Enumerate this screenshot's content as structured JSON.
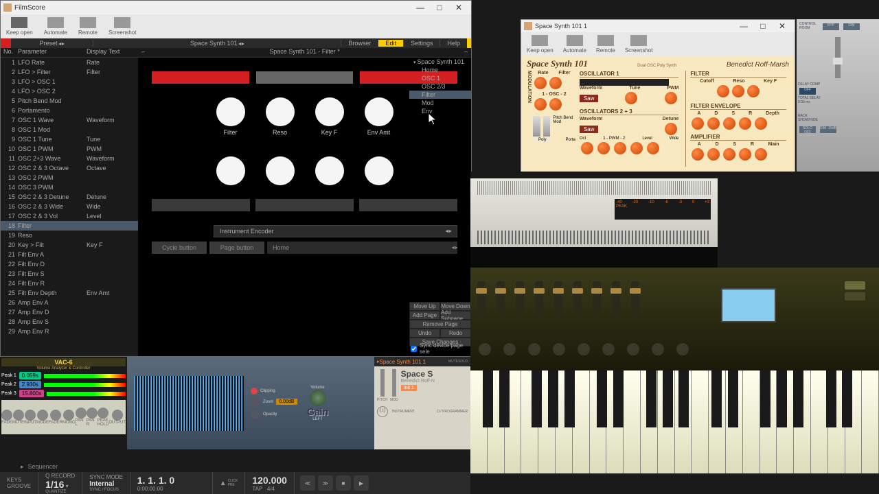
{
  "filmscore": {
    "title": "FilmScore",
    "toolbar": [
      "Keep open",
      "Automate",
      "Remote",
      "Screenshot"
    ],
    "menu": {
      "preset": "Preset",
      "device": "Space Synth 101",
      "browser": "Browser",
      "edit": "Edit",
      "settings": "Settings",
      "help": "Help"
    },
    "page_title": "Space Synth 101 - Filter *",
    "columns": {
      "no": "No.",
      "param": "Parameter",
      "display": "Display Text"
    },
    "params": [
      {
        "n": 1,
        "p": "LFO Rate",
        "d": "Rate"
      },
      {
        "n": 2,
        "p": "LFO > Filter",
        "d": "Filter"
      },
      {
        "n": 3,
        "p": "LFO > OSC 1",
        "d": ""
      },
      {
        "n": 4,
        "p": "LFO > OSC 2",
        "d": ""
      },
      {
        "n": 5,
        "p": "Pitch Bend Mod",
        "d": ""
      },
      {
        "n": 6,
        "p": "Portamento",
        "d": ""
      },
      {
        "n": 7,
        "p": "OSC 1 Wave",
        "d": "Waveform"
      },
      {
        "n": 8,
        "p": "OSC 1 Mod",
        "d": ""
      },
      {
        "n": 9,
        "p": "OSC 1 Tune",
        "d": "Tune"
      },
      {
        "n": 10,
        "p": "OSC 1 PWM",
        "d": "PWM"
      },
      {
        "n": 11,
        "p": "OSC 2+3 Wave",
        "d": "Waveform"
      },
      {
        "n": 12,
        "p": "OSC 2 & 3 Octave",
        "d": "Octave"
      },
      {
        "n": 13,
        "p": "OSC 2 PWM",
        "d": ""
      },
      {
        "n": 14,
        "p": "OSC 3 PWM",
        "d": ""
      },
      {
        "n": 15,
        "p": "OSC 2 & 3 Detune",
        "d": "Detune"
      },
      {
        "n": 16,
        "p": "OSC 2 & 3 Wide",
        "d": "Wide"
      },
      {
        "n": 17,
        "p": "OSC 2 & 3 Vol",
        "d": "Level"
      },
      {
        "n": 18,
        "p": "Filter",
        "d": ""
      },
      {
        "n": 19,
        "p": "Reso",
        "d": ""
      },
      {
        "n": 20,
        "p": "Key > Filt",
        "d": "Key F"
      },
      {
        "n": 21,
        "p": "Filt Env A",
        "d": ""
      },
      {
        "n": 22,
        "p": "Filt Env D",
        "d": ""
      },
      {
        "n": 23,
        "p": "Filt Env S",
        "d": ""
      },
      {
        "n": 24,
        "p": "Filt Env R",
        "d": ""
      },
      {
        "n": 25,
        "p": "Filt Env Depth",
        "d": "Env Amt"
      },
      {
        "n": 26,
        "p": "Amp Env A",
        "d": ""
      },
      {
        "n": 27,
        "p": "Amp Env D",
        "d": ""
      },
      {
        "n": 28,
        "p": "Amp Env S",
        "d": ""
      },
      {
        "n": 29,
        "p": "Amp Env R",
        "d": ""
      }
    ],
    "selected_param": 18,
    "knobs": [
      "Filter",
      "Reso",
      "Key F",
      "Env Amt"
    ],
    "encoder_dropdown": "Instrument Encoder",
    "btns": {
      "cycle": "Cycle button",
      "page": "Page button",
      "home": "Home"
    },
    "tree": {
      "root": "Space Synth 101",
      "items": [
        "Home",
        "OSC 1",
        "OSC 2/3",
        "Filter",
        "Mod",
        "Env"
      ]
    },
    "actions": [
      "Move Up",
      "Move Down",
      "Add Page",
      "Add Subpage",
      "Remove Page",
      "Undo",
      "Redo",
      "Save Changes"
    ],
    "sync": "Sync device page sele"
  },
  "synth": {
    "title": "Space Synth 101 1",
    "toolbar": [
      "Keep open",
      "Automate",
      "Remote",
      "Screenshot"
    ],
    "name": "Space Synth 101",
    "subtitle": "Dual OSC Poly Synth",
    "author": "Benedict Roff-Marsh",
    "mod_labels": [
      "Rate",
      "Filter"
    ],
    "mod_bottom": "1 - OSC - 2",
    "osc1": {
      "title": "OSCILLATOR 1",
      "labels": [
        "Waveform",
        "Tune",
        "PWM"
      ],
      "wave": "Saw"
    },
    "osc23": {
      "title": "OSCILLATORS 2 + 3",
      "labels": [
        "Waveform",
        "Detune"
      ],
      "wave": "Saw",
      "bottom": [
        "Oct",
        "1 - PWM - 2",
        "Level",
        "Wide"
      ]
    },
    "filter": {
      "title": "FILTER",
      "labels": [
        "Cutoff",
        "Reso",
        "Key F"
      ]
    },
    "filtenv": {
      "title": "FILTER ENVELOPE",
      "labels": [
        "A",
        "D",
        "S",
        "R",
        "Depth"
      ]
    },
    "amp": {
      "title": "AMPLIFIER",
      "labels": [
        "A",
        "D",
        "S",
        "R",
        "Main"
      ]
    },
    "pitch": "Pitch Bend Mod",
    "porta": "Porta",
    "poly": "Poly"
  },
  "transport": {
    "keys": "KEYS",
    "groove": "GROOVE",
    "qrecord": "Q RECORD",
    "quantize": "QUANTIZE",
    "q_val": "1/16",
    "sync": "SYNC MODE",
    "sync_val": "Internal",
    "sync_sub": "SYNC / FOCUS",
    "pos": "1.  1.  1.    0",
    "time": "0:00:00:00",
    "tempo": "120.000",
    "sig": "4/4",
    "tap": "TAP",
    "click": "CLICK",
    "pre": "PRE"
  },
  "sequencer": "Sequencer",
  "vac": {
    "title": "VAC-6",
    "sub": "Volume Analyzer & Controller",
    "peaks": [
      {
        "label": "Peak 1",
        "val": "0.059s"
      },
      {
        "label": "Peak 2",
        "val": "2.930s"
      },
      {
        "label": "Peak 3",
        "val": "15.800s"
      }
    ],
    "knobs": [
      "FADE",
      "MUTE",
      "INPUT",
      "MODE",
      "FADER",
      "MONO",
      "PAN L",
      "PAN R",
      "PEAK HOLD",
      "OUTPUT"
    ]
  },
  "mixer": {
    "clipping": "Clipping",
    "zoom": "Zoom",
    "opacity": "Opacity",
    "volume": "Volume",
    "volume_val": "0.00dB",
    "gain": "Gain",
    "left": "LEFT"
  },
  "strip": {
    "header": "Space Synth 101 1",
    "mute": "MUTE",
    "solo": "SOLO",
    "name": "Space S",
    "author": "Benedict Roff-N",
    "init": "Init 1",
    "pitch": "PITCH",
    "mod": "MOD",
    "instrument": "INSTRUMENT",
    "prog": "CV PROGRAMMER"
  },
  "rack_display": {
    "peak": "PEAK"
  },
  "right_rack": {
    "labels": [
      "CONTROL ROOM",
      "BYP",
      "DIM",
      "DELAY COMP",
      "OFF",
      "TOTAL DELAY",
      "0.00 ms",
      "RACK",
      "SHOW/HIDE",
      "SOLO OFF",
      "DIM -20dB"
    ]
  }
}
